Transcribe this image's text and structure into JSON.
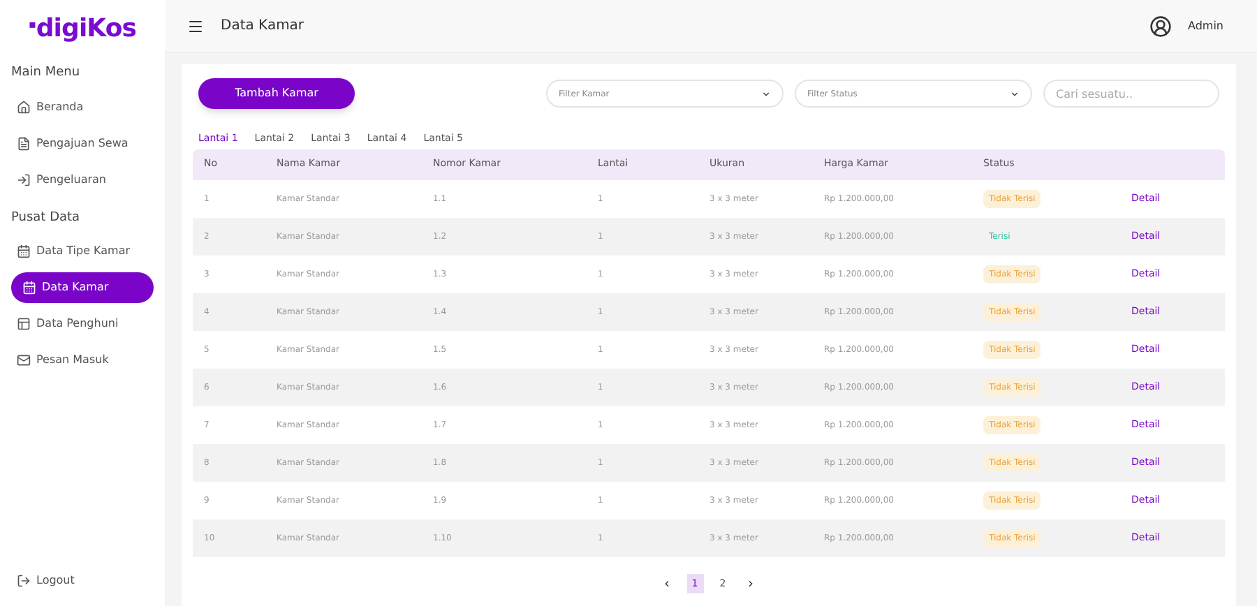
{
  "logo": {
    "mark": "▪",
    "text": "digiKos"
  },
  "header": {
    "title": "Data Kamar",
    "user": "Admin"
  },
  "sidebar": {
    "sections": [
      {
        "title": "Main Menu",
        "items": [
          {
            "label": "Beranda",
            "selected": false
          },
          {
            "label": "Pengajuan Sewa",
            "selected": false
          },
          {
            "label": "Pengeluaran",
            "selected": false
          }
        ]
      },
      {
        "title": "Pusat Data",
        "items": [
          {
            "label": "Data Tipe Kamar",
            "selected": false
          },
          {
            "label": "Data Kamar",
            "selected": true
          },
          {
            "label": "Data Penghuni",
            "selected": false
          },
          {
            "label": "Pesan Masuk",
            "selected": false
          }
        ]
      }
    ],
    "logout": "Logout"
  },
  "toolbar": {
    "add_button": "Tambah Kamar",
    "filters": [
      {
        "placeholder": "Filter Kamar"
      },
      {
        "placeholder": "Filter Status"
      }
    ],
    "search": {
      "placeholder": "Cari sesuatu.."
    }
  },
  "tabs": [
    {
      "label": "Lantai 1",
      "selected": true
    },
    {
      "label": "Lantai 2",
      "selected": false
    },
    {
      "label": "Lantai 3",
      "selected": false
    },
    {
      "label": "Lantai 4",
      "selected": false
    },
    {
      "label": "Lantai 5",
      "selected": false
    }
  ],
  "table": {
    "columns": [
      "No",
      "Nama Kamar",
      "Nomor Kamar",
      "Lantai",
      "Ukuran",
      "Harga Kamar",
      "Status"
    ],
    "rows": [
      {
        "no": "1",
        "name": "Kamar Standar",
        "number": "1.1",
        "floor": "1",
        "size": "3 x 3 meter",
        "price": "Rp 1.200.000,00",
        "status": {
          "text": "Tidak Terisi",
          "color": "#e8a33a",
          "highlighted": true
        },
        "action": "Detail"
      },
      {
        "no": "2",
        "name": "Kamar Standar",
        "number": "1.2",
        "floor": "1",
        "size": "3 x 3 meter",
        "price": "Rp 1.200.000,00",
        "status": {
          "text": "Terisi",
          "color": "#2fbf9b",
          "highlighted": false
        },
        "action": "Detail"
      },
      {
        "no": "3",
        "name": "Kamar Standar",
        "number": "1.3",
        "floor": "1",
        "size": "3 x 3 meter",
        "price": "Rp 1.200.000,00",
        "status": {
          "text": "Tidak Terisi",
          "color": "#e8a33a",
          "highlighted": true
        },
        "action": "Detail"
      },
      {
        "no": "4",
        "name": "Kamar Standar",
        "number": "1.4",
        "floor": "1",
        "size": "3 x 3 meter",
        "price": "Rp 1.200.000,00",
        "status": {
          "text": "Tidak Terisi",
          "color": "#e8a33a",
          "highlighted": true
        },
        "action": "Detail"
      },
      {
        "no": "5",
        "name": "Kamar Standar",
        "number": "1.5",
        "floor": "1",
        "size": "3 x 3 meter",
        "price": "Rp 1.200.000,00",
        "status": {
          "text": "Tidak Terisi",
          "color": "#e8a33a",
          "highlighted": true
        },
        "action": "Detail"
      },
      {
        "no": "6",
        "name": "Kamar Standar",
        "number": "1.6",
        "floor": "1",
        "size": "3 x 3 meter",
        "price": "Rp 1.200.000,00",
        "status": {
          "text": "Tidak Terisi",
          "color": "#e8a33a",
          "highlighted": true
        },
        "action": "Detail"
      },
      {
        "no": "7",
        "name": "Kamar Standar",
        "number": "1.7",
        "floor": "1",
        "size": "3 x 3 meter",
        "price": "Rp 1.200.000,00",
        "status": {
          "text": "Tidak Terisi",
          "color": "#e8a33a",
          "highlighted": true
        },
        "action": "Detail"
      },
      {
        "no": "8",
        "name": "Kamar Standar",
        "number": "1.8",
        "floor": "1",
        "size": "3 x 3 meter",
        "price": "Rp 1.200.000,00",
        "status": {
          "text": "Tidak Terisi",
          "color": "#e8a33a",
          "highlighted": true
        },
        "action": "Detail"
      },
      {
        "no": "9",
        "name": "Kamar Standar",
        "number": "1.9",
        "floor": "1",
        "size": "3 x 3 meter",
        "price": "Rp 1.200.000,00",
        "status": {
          "text": "Tidak Terisi",
          "color": "#e8a33a",
          "highlighted": true
        },
        "action": "Detail"
      },
      {
        "no": "10",
        "name": "Kamar Standar",
        "number": "1.10",
        "floor": "1",
        "size": "3 x 3 meter",
        "price": "Rp 1.200.000,00",
        "status": {
          "text": "Tidak Terisi",
          "color": "#e8a33a",
          "highlighted": true
        },
        "action": "Detail"
      }
    ]
  },
  "pagination": {
    "prev": "‹",
    "pages": [
      {
        "label": "1",
        "selected": true
      },
      {
        "label": "2",
        "selected": false
      }
    ],
    "next": "›"
  }
}
